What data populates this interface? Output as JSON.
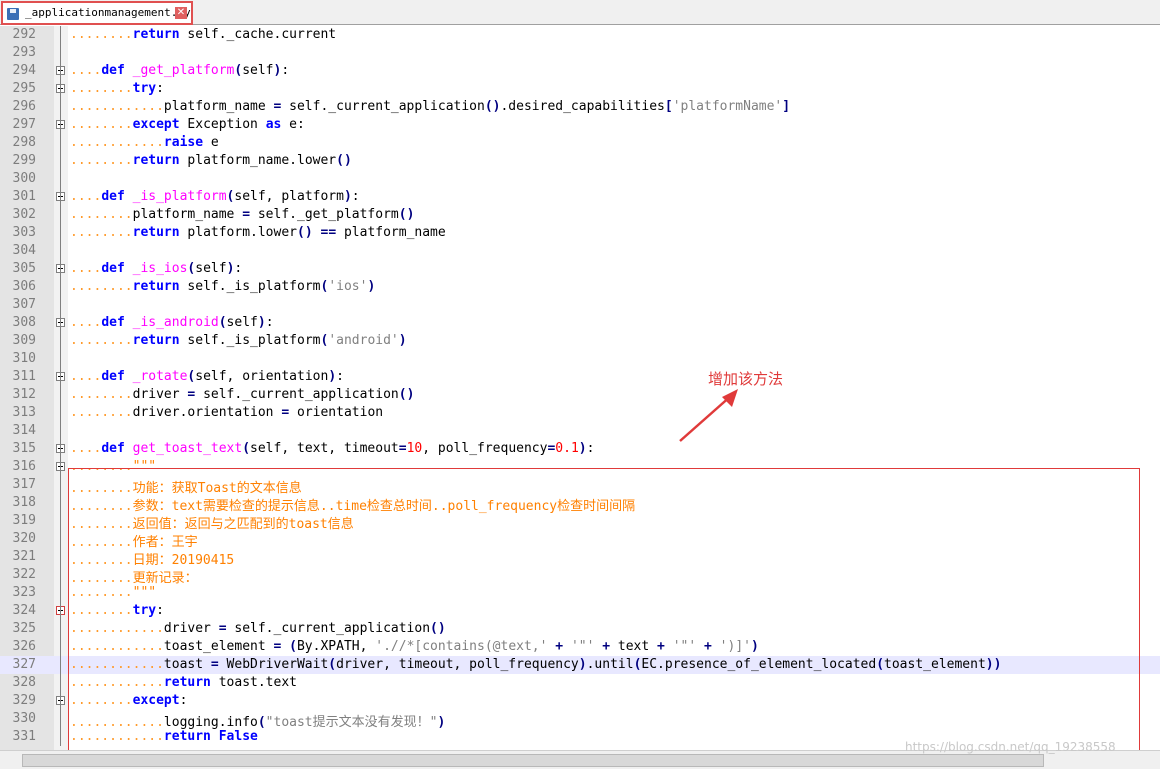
{
  "tab": {
    "filename": "_applicationmanagement.py",
    "close_glyph": "✕"
  },
  "annotation": "增加该方法",
  "watermark": "https://blog.csdn.net/qq_19238558",
  "colors": {
    "highlight_border": "#e03a3a",
    "keyword": "#0000ff",
    "function": "#ff00ff",
    "docstring": "#ff8000"
  },
  "lines": [
    {
      "n": "292",
      "code": "........return self._cache.current"
    },
    {
      "n": "293",
      "code": ""
    },
    {
      "n": "294",
      "code": "....def _get_platform(self):"
    },
    {
      "n": "295",
      "code": "........try:"
    },
    {
      "n": "296",
      "code": "............platform_name = self._current_application().desired_capabilities['platformName']"
    },
    {
      "n": "297",
      "code": "........except Exception as e:"
    },
    {
      "n": "298",
      "code": "............raise e"
    },
    {
      "n": "299",
      "code": "........return platform_name.lower()"
    },
    {
      "n": "300",
      "code": ""
    },
    {
      "n": "301",
      "code": "....def _is_platform(self, platform):"
    },
    {
      "n": "302",
      "code": "........platform_name = self._get_platform()"
    },
    {
      "n": "303",
      "code": "........return platform.lower() == platform_name"
    },
    {
      "n": "304",
      "code": ""
    },
    {
      "n": "305",
      "code": "....def _is_ios(self):"
    },
    {
      "n": "306",
      "code": "........return self._is_platform('ios')"
    },
    {
      "n": "307",
      "code": ""
    },
    {
      "n": "308",
      "code": "....def _is_android(self):"
    },
    {
      "n": "309",
      "code": "........return self._is_platform('android')"
    },
    {
      "n": "310",
      "code": ""
    },
    {
      "n": "311",
      "code": "....def _rotate(self, orientation):"
    },
    {
      "n": "312",
      "code": "........driver = self._current_application()"
    },
    {
      "n": "313",
      "code": "........driver.orientation = orientation"
    },
    {
      "n": "314",
      "code": ""
    },
    {
      "n": "315",
      "code": "....def get_toast_text(self, text, timeout=10, poll_frequency=0.1):"
    },
    {
      "n": "316",
      "code": "........\"\"\""
    },
    {
      "n": "317",
      "code": "........功能：获取Toast的文本信息"
    },
    {
      "n": "318",
      "code": "........参数：text需要检查的提示信息..time检查总时间..poll_frequency检查时间间隔"
    },
    {
      "n": "319",
      "code": "........返回值：返回与之匹配到的toast信息"
    },
    {
      "n": "320",
      "code": "........作者：王宇"
    },
    {
      "n": "321",
      "code": "........日期：20190415"
    },
    {
      "n": "322",
      "code": "........更新记录："
    },
    {
      "n": "323",
      "code": "........\"\"\""
    },
    {
      "n": "324",
      "code": "........try:"
    },
    {
      "n": "325",
      "code": "............driver = self._current_application()"
    },
    {
      "n": "326",
      "code": "............toast_element = (By.XPATH, './/*[contains(@text,' + '\"' + text + '\"' + ')]')"
    },
    {
      "n": "327",
      "code": "............toast = WebDriverWait(driver, timeout, poll_frequency).until(EC.presence_of_element_located(toast_element))"
    },
    {
      "n": "328",
      "code": "............return toast.text"
    },
    {
      "n": "329",
      "code": "........except:"
    },
    {
      "n": "330",
      "code": "............logging.info(\"toast提示文本没有发现！\")"
    },
    {
      "n": "331",
      "code": "............return False"
    }
  ]
}
